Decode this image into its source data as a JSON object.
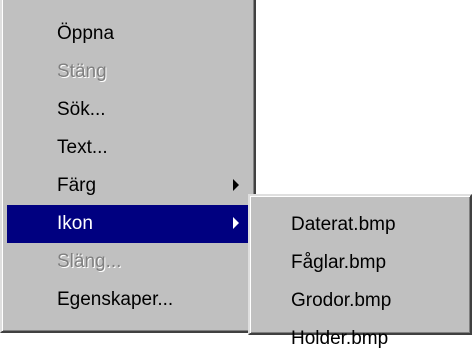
{
  "main_menu": {
    "items": [
      {
        "label": "Öppna"
      },
      {
        "label": "Stäng"
      },
      {
        "label": "Sök..."
      },
      {
        "label": "Text..."
      },
      {
        "label": "Färg"
      },
      {
        "label": "Ikon"
      },
      {
        "label": "Släng..."
      },
      {
        "label": "Egenskaper..."
      }
    ]
  },
  "submenu": {
    "items": [
      {
        "label": "Daterat.bmp"
      },
      {
        "label": "Fåglar.bmp"
      },
      {
        "label": "Grodor.bmp"
      },
      {
        "label": "Holder.bmp"
      }
    ]
  },
  "colors": {
    "menu_bg": "#c0c0c0",
    "highlight": "#000080",
    "disabled_text": "#808080"
  },
  "icons": {
    "submenu_arrow": "chevron-right-icon"
  }
}
